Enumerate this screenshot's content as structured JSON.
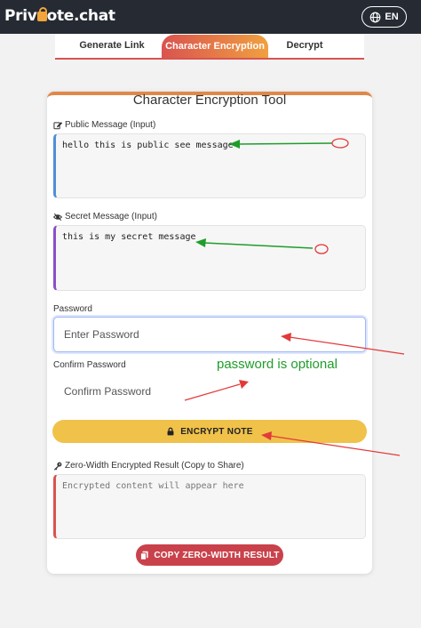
{
  "header": {
    "logo_text_before": "Priv",
    "logo_text_after": "ote.chat",
    "language": "EN"
  },
  "tabs": [
    {
      "label": "Generate Link"
    },
    {
      "label": "Character Encryption",
      "active": true
    },
    {
      "label": "Decrypt"
    }
  ],
  "tool": {
    "title": "Character Encryption Tool",
    "public_label": "Public Message (Input)",
    "public_value": "hello this is public see message",
    "secret_label": "Secret Message (Input)",
    "secret_value": "this is my secret message",
    "password_label": "Password",
    "password_placeholder": "Enter Password",
    "confirm_label": "Confirm Password",
    "confirm_placeholder": "Confirm Password",
    "encrypt_button": "ENCRYPT NOTE",
    "result_label": "Zero-Width Encrypted Result (Copy to Share)",
    "result_placeholder": "Encrypted content will appear here",
    "copy_button": "COPY ZERO-WIDTH RESULT"
  },
  "annotations": {
    "note": "password is optional",
    "green": "#1f9d2a",
    "red": "#e23a3a"
  },
  "colors": {
    "header_bg": "#262a33",
    "encrypt_button": "#f0c24a",
    "copy_button": "#c9424b",
    "accent": "#d9534f"
  }
}
